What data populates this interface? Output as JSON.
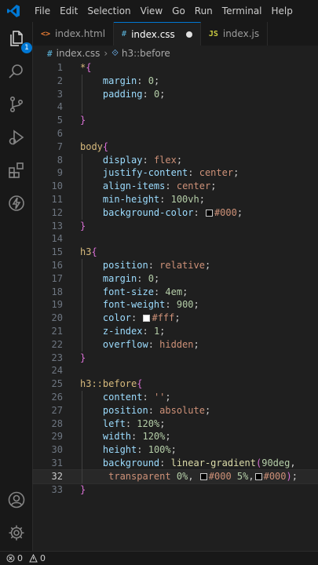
{
  "menu": [
    "File",
    "Edit",
    "Selection",
    "View",
    "Go",
    "Run",
    "Terminal",
    "Help"
  ],
  "activity": {
    "explorer_badge": "1",
    "icons": [
      "files-icon",
      "search-icon",
      "source-control-icon",
      "run-debug-icon",
      "extensions-icon",
      "lightning-icon",
      "account-icon",
      "settings-gear-icon"
    ]
  },
  "tabs": [
    {
      "label": "index.html",
      "icon": "<>",
      "icon_color": "#e37933",
      "active": false
    },
    {
      "label": "index.css",
      "icon": "#",
      "icon_color": "#519aba",
      "active": true,
      "modified": true
    },
    {
      "label": "index.js",
      "icon": "JS",
      "icon_color": "#cbcb41",
      "active": false
    }
  ],
  "breadcrumb": {
    "file_icon": "#",
    "file": "index.css",
    "symbol": "h3::before"
  },
  "editor": {
    "current_line": 32,
    "lines": [
      {
        "n": "1",
        "tokens": [
          [
            "sel",
            "*"
          ],
          [
            "brace",
            "{"
          ]
        ]
      },
      {
        "n": "2",
        "tokens": [
          [
            "sp",
            "    "
          ],
          [
            "prop",
            "margin"
          ],
          [
            "pun",
            ": "
          ],
          [
            "num",
            "0"
          ],
          [
            "pun",
            ";"
          ]
        ]
      },
      {
        "n": "3",
        "tokens": [
          [
            "sp",
            "    "
          ],
          [
            "prop",
            "padding"
          ],
          [
            "pun",
            ": "
          ],
          [
            "num",
            "0"
          ],
          [
            "pun",
            ";"
          ]
        ]
      },
      {
        "n": "4",
        "tokens": []
      },
      {
        "n": "5",
        "tokens": [
          [
            "brace",
            "}"
          ]
        ]
      },
      {
        "n": "6",
        "tokens": []
      },
      {
        "n": "7",
        "tokens": [
          [
            "sel",
            "body"
          ],
          [
            "brace",
            "{"
          ]
        ]
      },
      {
        "n": "8",
        "tokens": [
          [
            "sp",
            "    "
          ],
          [
            "prop",
            "display"
          ],
          [
            "pun",
            ": "
          ],
          [
            "val",
            "flex"
          ],
          [
            "pun",
            ";"
          ]
        ]
      },
      {
        "n": "9",
        "tokens": [
          [
            "sp",
            "    "
          ],
          [
            "prop",
            "justify-content"
          ],
          [
            "pun",
            ": "
          ],
          [
            "val",
            "center"
          ],
          [
            "pun",
            ";"
          ]
        ]
      },
      {
        "n": "10",
        "tokens": [
          [
            "sp",
            "    "
          ],
          [
            "prop",
            "align-items"
          ],
          [
            "pun",
            ": "
          ],
          [
            "val",
            "center"
          ],
          [
            "pun",
            ";"
          ]
        ]
      },
      {
        "n": "11",
        "tokens": [
          [
            "sp",
            "    "
          ],
          [
            "prop",
            "min-height"
          ],
          [
            "pun",
            ": "
          ],
          [
            "num",
            "100"
          ],
          [
            "unit",
            "vh"
          ],
          [
            "pun",
            ";"
          ]
        ]
      },
      {
        "n": "12",
        "tokens": [
          [
            "sp",
            "    "
          ],
          [
            "prop",
            "background-color"
          ],
          [
            "pun",
            ": "
          ],
          [
            "swatch",
            "#000000"
          ],
          [
            "val",
            "#000"
          ],
          [
            "pun",
            ";"
          ]
        ]
      },
      {
        "n": "13",
        "tokens": [
          [
            "brace",
            "}"
          ]
        ]
      },
      {
        "n": "14",
        "tokens": []
      },
      {
        "n": "15",
        "tokens": [
          [
            "sel",
            "h3"
          ],
          [
            "brace",
            "{"
          ]
        ]
      },
      {
        "n": "16",
        "tokens": [
          [
            "sp",
            "    "
          ],
          [
            "prop",
            "position"
          ],
          [
            "pun",
            ": "
          ],
          [
            "val",
            "relative"
          ],
          [
            "pun",
            ";"
          ]
        ]
      },
      {
        "n": "17",
        "tokens": [
          [
            "sp",
            "    "
          ],
          [
            "prop",
            "margin"
          ],
          [
            "pun",
            ": "
          ],
          [
            "num",
            "0"
          ],
          [
            "pun",
            ";"
          ]
        ]
      },
      {
        "n": "18",
        "tokens": [
          [
            "sp",
            "    "
          ],
          [
            "prop",
            "font-size"
          ],
          [
            "pun",
            ": "
          ],
          [
            "num",
            "4"
          ],
          [
            "unit",
            "em"
          ],
          [
            "pun",
            ";"
          ]
        ]
      },
      {
        "n": "19",
        "tokens": [
          [
            "sp",
            "    "
          ],
          [
            "prop",
            "font-weight"
          ],
          [
            "pun",
            ": "
          ],
          [
            "num",
            "900"
          ],
          [
            "pun",
            ";"
          ]
        ]
      },
      {
        "n": "20",
        "tokens": [
          [
            "sp",
            "    "
          ],
          [
            "prop",
            "color"
          ],
          [
            "pun",
            ": "
          ],
          [
            "swatch",
            "#ffffff"
          ],
          [
            "val",
            "#fff"
          ],
          [
            "pun",
            ";"
          ]
        ]
      },
      {
        "n": "21",
        "tokens": [
          [
            "sp",
            "    "
          ],
          [
            "prop",
            "z-index"
          ],
          [
            "pun",
            ": "
          ],
          [
            "num",
            "1"
          ],
          [
            "pun",
            ";"
          ]
        ]
      },
      {
        "n": "22",
        "tokens": [
          [
            "sp",
            "    "
          ],
          [
            "prop",
            "overflow"
          ],
          [
            "pun",
            ": "
          ],
          [
            "val",
            "hidden"
          ],
          [
            "pun",
            ";"
          ]
        ]
      },
      {
        "n": "23",
        "tokens": [
          [
            "brace",
            "}"
          ]
        ]
      },
      {
        "n": "24",
        "tokens": []
      },
      {
        "n": "25",
        "tokens": [
          [
            "sel",
            "h3::before"
          ],
          [
            "brace",
            "{"
          ]
        ]
      },
      {
        "n": "26",
        "tokens": [
          [
            "sp",
            "    "
          ],
          [
            "prop",
            "content"
          ],
          [
            "pun",
            ": "
          ],
          [
            "val",
            "''"
          ],
          [
            "pun",
            ";"
          ]
        ]
      },
      {
        "n": "27",
        "tokens": [
          [
            "sp",
            "    "
          ],
          [
            "prop",
            "position"
          ],
          [
            "pun",
            ": "
          ],
          [
            "val",
            "absolute"
          ],
          [
            "pun",
            ";"
          ]
        ]
      },
      {
        "n": "28",
        "tokens": [
          [
            "sp",
            "    "
          ],
          [
            "prop",
            "left"
          ],
          [
            "pun",
            ": "
          ],
          [
            "num",
            "120"
          ],
          [
            "pct",
            "%"
          ],
          [
            "pun",
            ";"
          ]
        ]
      },
      {
        "n": "29",
        "tokens": [
          [
            "sp",
            "    "
          ],
          [
            "prop",
            "width"
          ],
          [
            "pun",
            ": "
          ],
          [
            "num",
            "120"
          ],
          [
            "pct",
            "%"
          ],
          [
            "pun",
            ";"
          ]
        ]
      },
      {
        "n": "30",
        "tokens": [
          [
            "sp",
            "    "
          ],
          [
            "prop",
            "height"
          ],
          [
            "pun",
            ": "
          ],
          [
            "num",
            "100"
          ],
          [
            "pct",
            "%"
          ],
          [
            "pun",
            ";"
          ]
        ]
      },
      {
        "n": "31",
        "tokens": [
          [
            "sp",
            "    "
          ],
          [
            "prop",
            "background"
          ],
          [
            "pun",
            ": "
          ],
          [
            "fn",
            "linear-gradient"
          ],
          [
            "paren",
            "("
          ],
          [
            "num",
            "90"
          ],
          [
            "unit",
            "deg"
          ],
          [
            "pun",
            ","
          ]
        ]
      },
      {
        "n": "32",
        "tokens": [
          [
            "sp",
            "     "
          ],
          [
            "val",
            "transparent"
          ],
          [
            "pun",
            " "
          ],
          [
            "num",
            "0"
          ],
          [
            "pct",
            "%"
          ],
          [
            "pun",
            ", "
          ],
          [
            "swatch",
            "#000000"
          ],
          [
            "val",
            "#000"
          ],
          [
            "pun",
            " "
          ],
          [
            "num",
            "5"
          ],
          [
            "pct",
            "%"
          ],
          [
            "pun",
            ","
          ],
          [
            "swatch",
            "#000000"
          ],
          [
            "val",
            "#000"
          ],
          [
            "paren",
            ")"
          ],
          [
            "pun",
            ";"
          ]
        ]
      },
      {
        "n": "33",
        "tokens": [
          [
            "brace",
            "}"
          ]
        ]
      }
    ]
  },
  "status": {
    "errors": "0",
    "warnings": "0"
  }
}
